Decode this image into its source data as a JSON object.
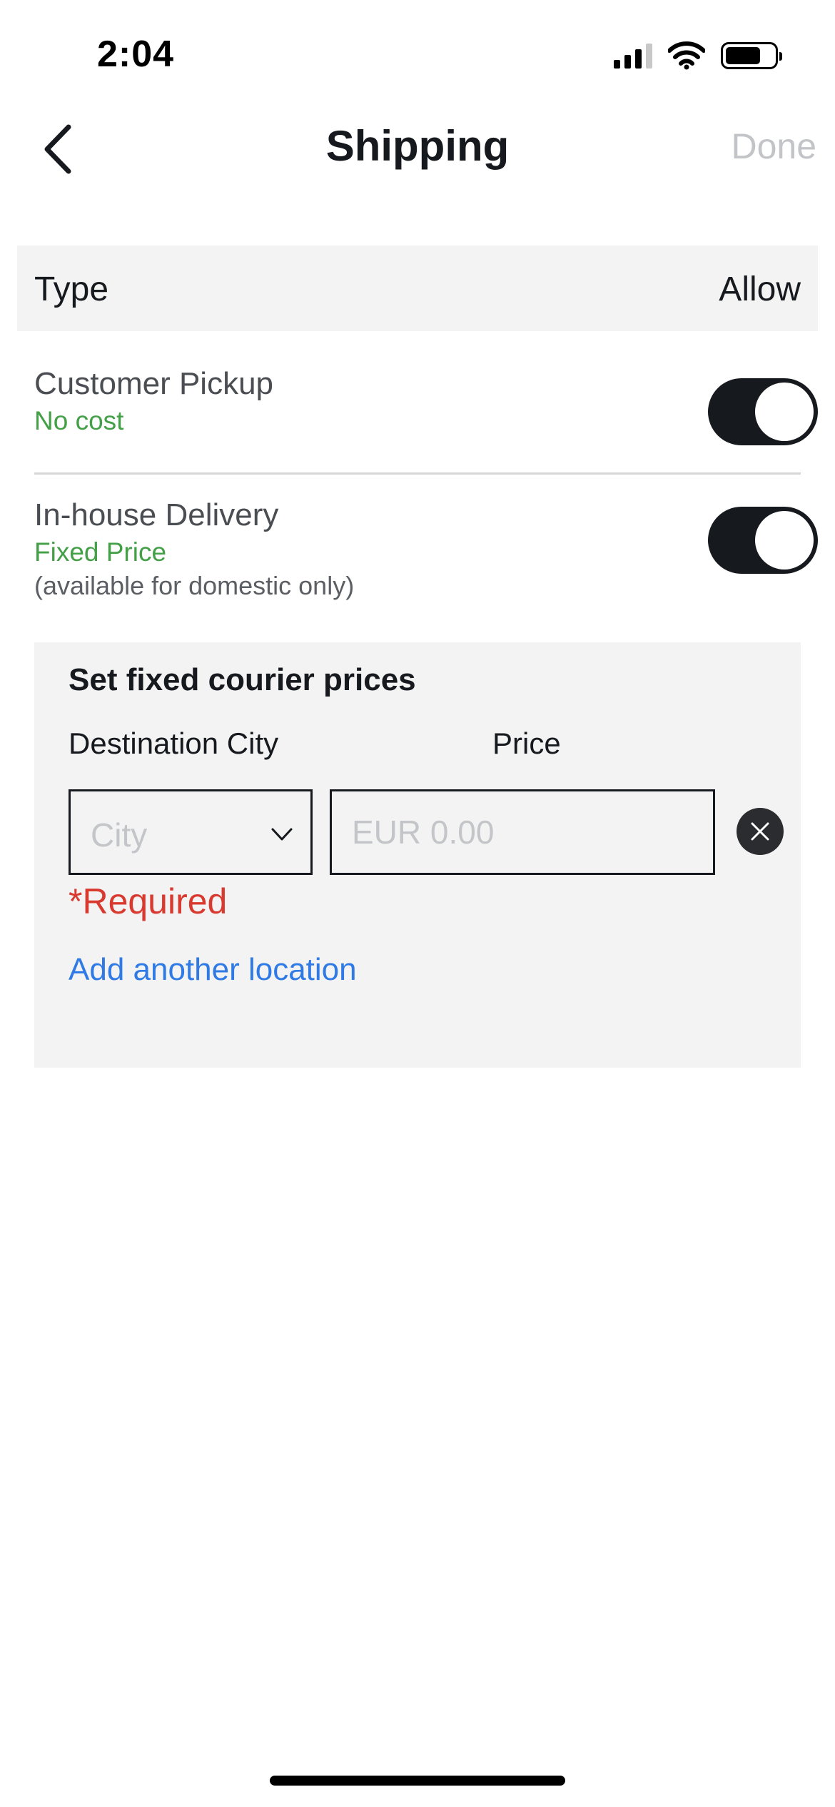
{
  "status_bar": {
    "time": "2:04"
  },
  "nav": {
    "title": "Shipping",
    "done_label": "Done"
  },
  "type_header": {
    "label": "Type",
    "value": "Allow"
  },
  "options": [
    {
      "title": "Customer Pickup",
      "subtitle": "No cost",
      "note": "",
      "enabled": true
    },
    {
      "title": "In-house Delivery",
      "subtitle": "Fixed Price",
      "note": "(available for domestic only)",
      "enabled": true
    }
  ],
  "courier": {
    "heading": "Set fixed courier prices",
    "col_city": "Destination City",
    "col_price": "Price",
    "city_placeholder": "City",
    "price_placeholder": "EUR 0.00",
    "required_text": "*Required",
    "add_location_label": "Add another location"
  },
  "colors": {
    "accent_green": "#43a047",
    "link_blue": "#2f7ae5",
    "error_red": "#d93a2f",
    "toggle_on": "#16191e"
  }
}
